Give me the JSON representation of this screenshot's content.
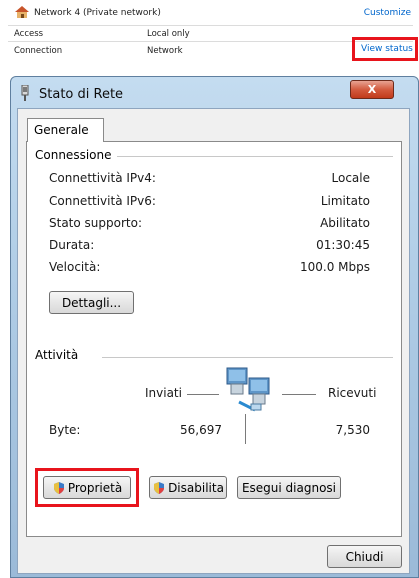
{
  "network_panel": {
    "network_name": "Network 4 (Private network)",
    "customize_label": "Customize",
    "rows": [
      {
        "label": "Access",
        "value": "Local only"
      },
      {
        "label": "Connection",
        "value": "Network"
      }
    ],
    "view_status_label": "View status"
  },
  "dialog": {
    "title": "Stato di Rete",
    "close_label": "X",
    "tab_label": "Generale",
    "connection_group": {
      "title": "Connessione",
      "items": [
        {
          "label": "Connettività IPv4:",
          "value": "Locale"
        },
        {
          "label": "Connettività IPv6:",
          "value": "Limitato"
        },
        {
          "label": "Stato supporto:",
          "value": "Abilitato"
        },
        {
          "label": "Durata:",
          "value": "01:30:45"
        },
        {
          "label": "Velocità:",
          "value": "100.0 Mbps"
        }
      ],
      "details_button": "Dettagli..."
    },
    "activity_group": {
      "title": "Attività",
      "sent_label": "Inviati",
      "received_label": "Ricevuti",
      "bytes_label": "Byte:",
      "bytes_sent": "56,697",
      "bytes_received": "7,530"
    },
    "buttons": {
      "properties": "Proprietà",
      "disable": "Disabilita",
      "diagnose": "Esegui diagnosi",
      "close": "Chiudi"
    }
  },
  "colors": {
    "highlight": "#e8141c",
    "link": "#0066cc"
  }
}
